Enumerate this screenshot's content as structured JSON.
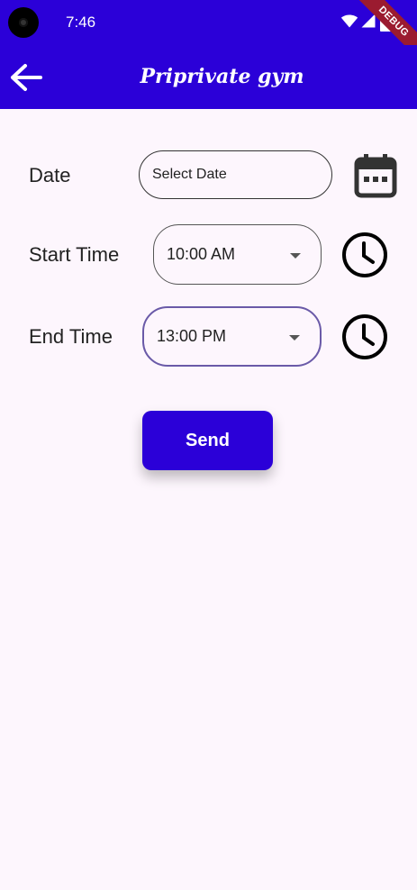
{
  "status_bar": {
    "time": "7:46",
    "debug_label": "DEBUG"
  },
  "app_bar": {
    "title": "Priprivate gym",
    "background": "#2b00d8"
  },
  "form": {
    "date": {
      "label": "Date",
      "placeholder": "Select Date"
    },
    "start_time": {
      "label": "Start Time",
      "value": "10:00 AM"
    },
    "end_time": {
      "label": "End Time",
      "value": "13:00 PM"
    },
    "send_label": "Send"
  },
  "icons": {
    "back": "arrow-left-icon",
    "calendar": "calendar-icon",
    "clock": "clock-icon"
  }
}
